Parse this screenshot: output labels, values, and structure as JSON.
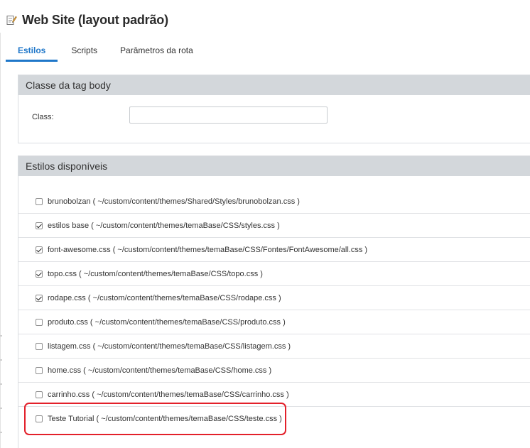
{
  "page": {
    "title": "Web Site (layout padrão)",
    "icon": "edit-page-icon"
  },
  "tabs": [
    {
      "label": "Estilos",
      "active": true
    },
    {
      "label": "Scripts",
      "active": false
    },
    {
      "label": "Parâmetros da rota",
      "active": false
    }
  ],
  "body_class_panel": {
    "heading": "Classe da tag body",
    "class_label": "Class:",
    "class_value": ""
  },
  "styles_panel": {
    "heading": "Estilos disponíveis",
    "items": [
      {
        "label": "brunobolzan ( ~/custom/content/themes/Shared/Styles/brunobolzan.css )",
        "checked": false
      },
      {
        "label": "estilos base ( ~/custom/content/themes/temaBase/CSS/styles.css )",
        "checked": true
      },
      {
        "label": "font-awesome.css ( ~/custom/content/themes/temaBase/CSS/Fontes/FontAwesome/all.css )",
        "checked": true
      },
      {
        "label": "topo.css ( ~/custom/content/themes/temaBase/CSS/topo.css )",
        "checked": true
      },
      {
        "label": "rodape.css ( ~/custom/content/themes/temaBase/CSS/rodape.css )",
        "checked": true
      },
      {
        "label": "produto.css ( ~/custom/content/themes/temaBase/CSS/produto.css )",
        "checked": false
      },
      {
        "label": "listagem.css ( ~/custom/content/themes/temaBase/CSS/listagem.css )",
        "checked": false
      },
      {
        "label": "home.css ( ~/custom/content/themes/temaBase/CSS/home.css )",
        "checked": false
      },
      {
        "label": "carrinho.css ( ~/custom/content/themes/temaBase/CSS/carrinho.css )",
        "checked": false
      },
      {
        "label": "Teste Tutorial ( ~/custom/content/themes/temaBase/CSS/teste.css )",
        "checked": false
      }
    ]
  },
  "colors": {
    "accent": "#1f77c9",
    "panel_header": "#d3d7db",
    "highlight": "#e3202a"
  }
}
